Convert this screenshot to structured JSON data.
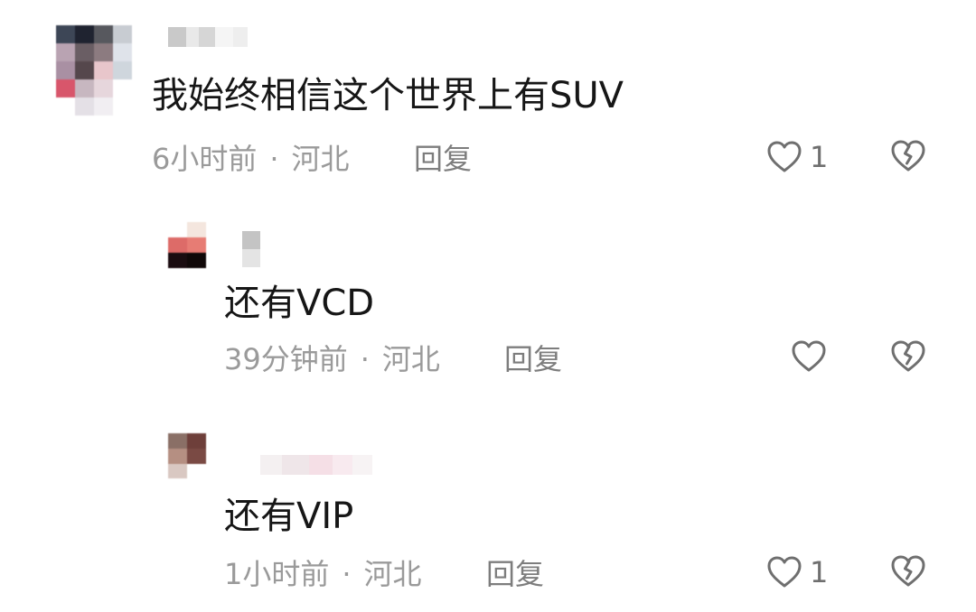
{
  "comments": [
    {
      "text": "我始终相信这个世界上有SUV",
      "time": "6小时前",
      "separator": "·",
      "location": "河北",
      "reply_label": "回复",
      "like_count": "1"
    },
    {
      "text": "还有VCD",
      "time": "39分钟前",
      "separator": "·",
      "location": "河北",
      "reply_label": "回复",
      "like_count": ""
    },
    {
      "text": "还有VIP",
      "time": "1小时前",
      "separator": "·",
      "location": "河北",
      "reply_label": "回复",
      "like_count": "1"
    }
  ],
  "icons": {
    "like": "heart-outline-icon",
    "dislike": "broken-heart-icon"
  },
  "colors": {
    "text": "#161616",
    "meta": "#9a9a9a",
    "icon": "#6f6f6f"
  }
}
